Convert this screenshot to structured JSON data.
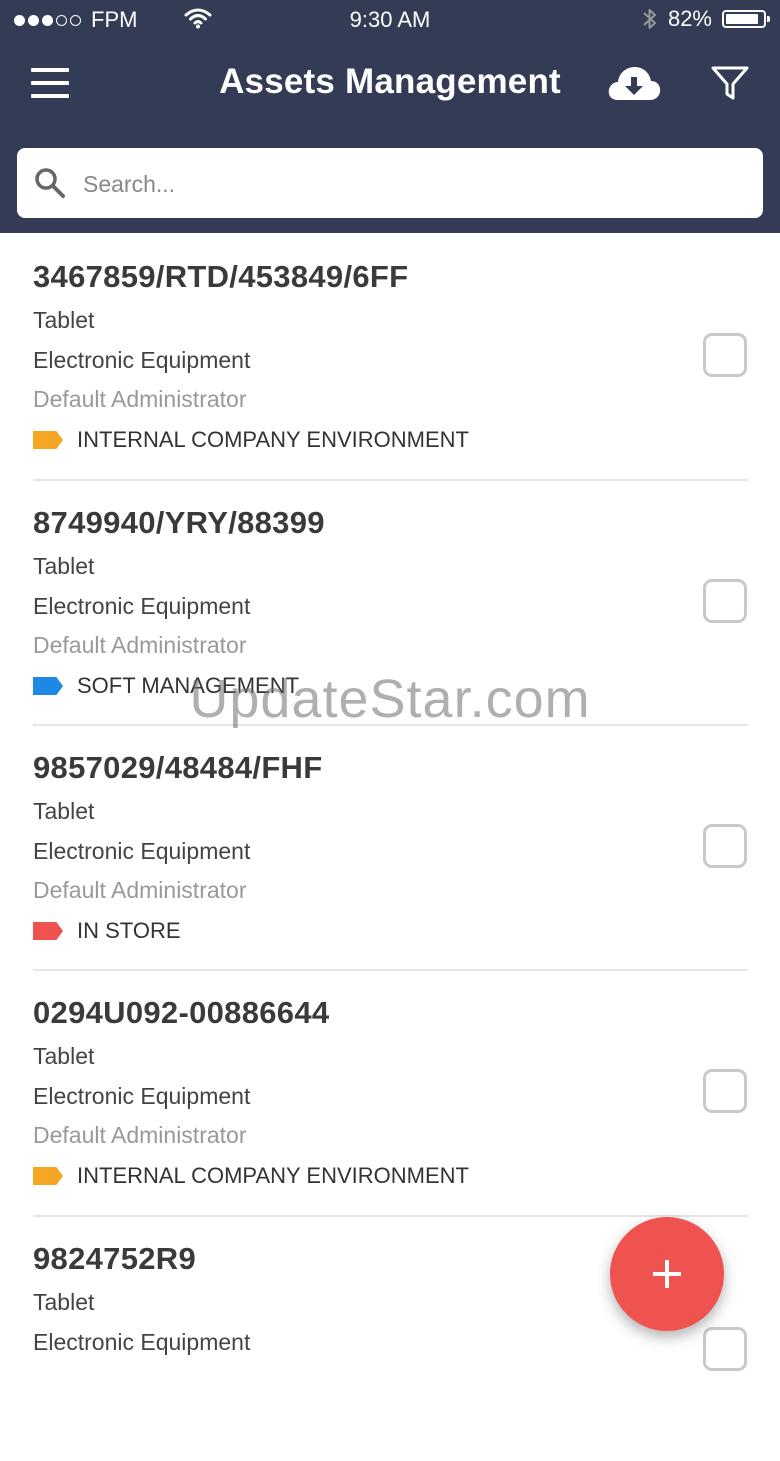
{
  "status_bar": {
    "carrier": "FPM",
    "time": "9:30 AM",
    "battery_percent": "82%"
  },
  "header": {
    "title": "Assets Management",
    "menu_icon": "hamburger-menu-icon",
    "download_icon": "cloud-download-icon",
    "filter_icon": "filter-icon"
  },
  "search": {
    "placeholder": "Search..."
  },
  "assets": [
    {
      "code": "3467859/RTD/453849/6FF",
      "type": "Tablet",
      "category": "Electronic Equipment",
      "owner": "Default Administrator",
      "location": "INTERNAL COMPANY ENVIRONMENT",
      "tag_color": "#f5a623"
    },
    {
      "code": "8749940/YRY/88399",
      "type": "Tablet",
      "category": "Electronic Equipment",
      "owner": "Default Administrator",
      "location": "SOFT MANAGEMENT",
      "tag_color": "#1e88e5"
    },
    {
      "code": "9857029/48484/FHF",
      "type": "Tablet",
      "category": "Electronic Equipment",
      "owner": "Default Administrator",
      "location": "IN STORE",
      "tag_color": "#ef5350"
    },
    {
      "code": "0294U092-00886644",
      "type": "Tablet",
      "category": "Electronic Equipment",
      "owner": "Default Administrator",
      "location": "INTERNAL COMPANY ENVIRONMENT",
      "tag_color": "#f5a623"
    },
    {
      "code": "9824752R9",
      "type": "Tablet",
      "category": "Electronic Equipment"
    }
  ],
  "fab": {
    "icon": "plus-icon",
    "color": "#ef5350"
  },
  "watermark": "UpdateStar.com",
  "colors": {
    "header_bg": "#343b54",
    "accent": "#ef5350"
  }
}
